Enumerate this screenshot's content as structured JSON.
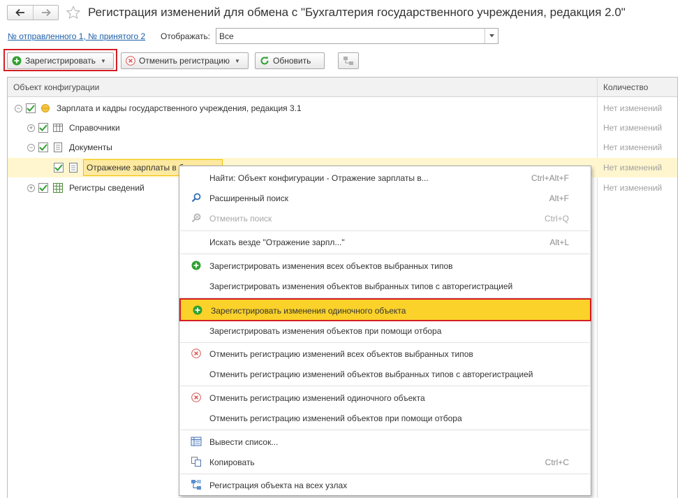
{
  "window": {
    "title": "Регистрация изменений для обмена с  \"Бухгалтерия государственного учреждения, редакция 2.0\""
  },
  "filter": {
    "message_link": "№ отправленного 1, № принятого 2",
    "show_label": "Отображать:",
    "show_value": "Все"
  },
  "toolbar": {
    "register_label": "Зарегистрировать",
    "cancel_label": "Отменить регистрацию",
    "refresh_label": "Обновить"
  },
  "table": {
    "col_object": "Объект конфигурации",
    "col_quantity": "Количество",
    "rows": [
      {
        "label": "Зарплата и кадры государственного учреждения, редакция 3.1",
        "qty": "Нет изменений"
      },
      {
        "label": "Справочники",
        "qty": "Нет изменений"
      },
      {
        "label": "Документы",
        "qty": "Нет изменений"
      },
      {
        "label": "Отражение зарплаты в б",
        "qty": "Нет изменений"
      },
      {
        "label": "Регистры сведений",
        "qty": "Нет изменений"
      }
    ]
  },
  "menu": {
    "items": [
      {
        "label": "Найти: Объект конфигурации - Отражение зарплаты в...",
        "shortcut": "Ctrl+Alt+F"
      },
      {
        "label": "Расширенный поиск",
        "shortcut": "Alt+F"
      },
      {
        "label": "Отменить поиск",
        "shortcut": "Ctrl+Q"
      },
      {
        "label": "Искать везде \"Отражение зарпл...\"",
        "shortcut": "Alt+L"
      },
      {
        "label": "Зарегистрировать изменения всех объектов выбранных типов"
      },
      {
        "label": "Зарегистрировать изменения объектов выбранных типов с авторегистрацией"
      },
      {
        "label": "Зарегистрировать изменения одиночного объекта"
      },
      {
        "label": "Зарегистрировать изменения объектов при помощи отбора"
      },
      {
        "label": "Отменить регистрацию изменений всех объектов выбранных типов"
      },
      {
        "label": "Отменить регистрацию изменений объектов выбранных типов с авторегистрацией"
      },
      {
        "label": "Отменить регистрацию изменений одиночного объекта"
      },
      {
        "label": "Отменить регистрацию изменений объектов при помощи отбора"
      },
      {
        "label": "Вывести список..."
      },
      {
        "label": "Копировать",
        "shortcut": "Ctrl+C"
      },
      {
        "label": "Регистрация объекта на всех узлах"
      }
    ]
  },
  "colors": {
    "highlight_border": "#d41e24",
    "menu_active_bg": "#fbd229",
    "selected_row_bg": "#fff6cf",
    "link": "#1c5ea8",
    "check_green": "#2ea12e"
  },
  "icons": {
    "back": "arrow-left-icon",
    "forward": "arrow-right-icon",
    "favorite": "star-icon",
    "add": "plus-circle-icon",
    "cancel": "x-circle-icon",
    "refresh": "refresh-icon",
    "search": "magnifier-icon",
    "print_list": "list-output-icon",
    "copy": "copy-icon",
    "nodes": "network-nodes-icon"
  }
}
